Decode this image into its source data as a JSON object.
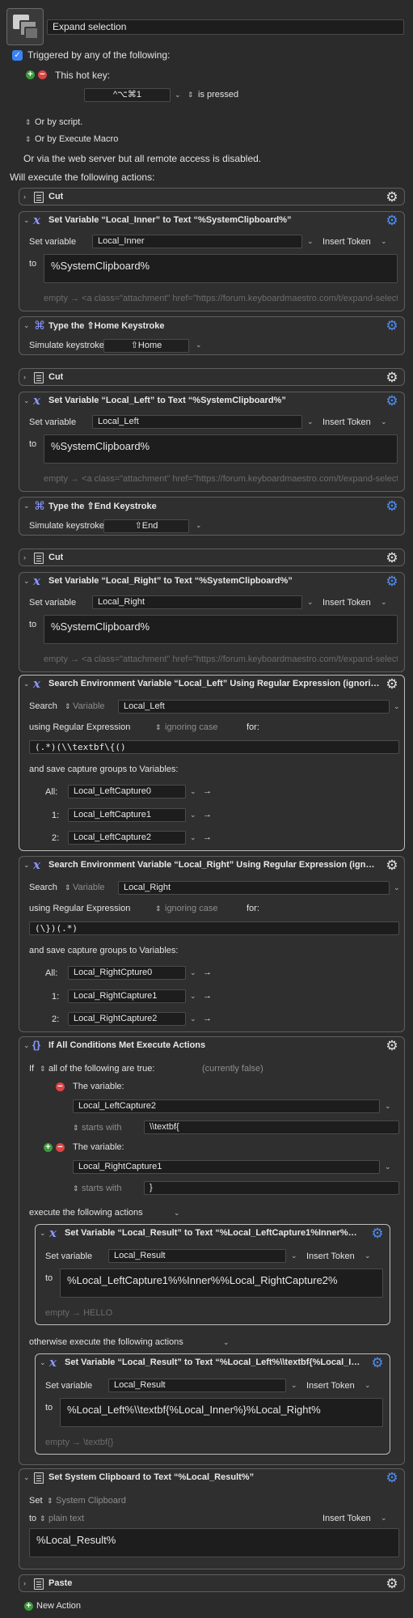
{
  "macro": {
    "name": "Expand selection"
  },
  "trigger": {
    "checkbox_label": "Triggered by any of the following:",
    "hotkey_label": "This hot key:",
    "hotkey_value": "^⌥⌘1",
    "hotkey_state": "is pressed",
    "or_by_script": "Or by script.",
    "or_by_macro": "Or by Execute Macro",
    "web_server": "Or via the web server but all remote access is disabled.",
    "will_execute": "Will execute the following actions:"
  },
  "common": {
    "set_variable": "Set variable",
    "to": "to",
    "insert_token": "Insert Token",
    "simulate_keystroke": "Simulate keystroke:",
    "search": "Search",
    "variable": "Variable",
    "using_regex": "using Regular Expression",
    "ignoring_case": "ignoring case",
    "for": "for:",
    "save_capture": "and save capture groups to Variables:",
    "all": "All:",
    "one": "1:",
    "two": "2:",
    "link_placeholder": "empty → <a class=\"attachment\" href=\"https://forum.keyboardmaestro.com/t/expand-selection-macro/"
  },
  "actions": [
    {
      "title": "Cut"
    },
    {
      "title": "Set Variable “Local_Inner” to Text “%SystemClipboard%”",
      "var": "Local_Inner",
      "text": "%SystemClipboard%"
    },
    {
      "title": "Type the ⇧Home Keystroke",
      "key": "⇧Home"
    },
    {
      "title": "Cut"
    },
    {
      "title": "Set Variable “Local_Left” to Text “%SystemClipboard%”",
      "var": "Local_Left",
      "text": "%SystemClipboard%"
    },
    {
      "title": "Type the ⇧End Keystroke",
      "key": "⇧End"
    },
    {
      "title": "Cut"
    },
    {
      "title": "Set Variable “Local_Right” to Text “%SystemClipboard%”",
      "var": "Local_Right",
      "text": "%SystemClipboard%"
    },
    {
      "title": "Search Environment Variable “Local_Left” Using Regular Expression (ignoring case)",
      "var": "Local_Left",
      "regex": "(.*)(\\\\textbf\\{()",
      "all": "Local_LeftCapture0",
      "c1": "Local_LeftCapture1",
      "c2": "Local_LeftCapture2"
    },
    {
      "title": "Search Environment Variable “Local_Right” Using Regular Expression (ignoring case)",
      "var": "Local_Right",
      "regex": "(\\})(.*)",
      "all": "Local_RightCpture0",
      "c1": "Local_RightCapture1",
      "c2": "Local_RightCapture2"
    },
    {
      "title": "If All Conditions Met Execute Actions",
      "if": "If",
      "all_following": "all of the following are true:",
      "currently": "(currently false)",
      "the_variable": "The variable:",
      "cond1_var": "Local_LeftCapture2",
      "starts_with": "starts with",
      "cond1_val": "\\\\textbf{",
      "cond2_var": "Local_RightCapture1",
      "cond2_val": "}",
      "execute_following": "execute the following actions",
      "then_title": "Set Variable “Local_Result” to Text “%Local_LeftCapture1%Inner%%Local_RightCapture2%”",
      "then_var": "Local_Result",
      "then_text": "%Local_LeftCapture1%%Inner%%Local_RightCapture2%",
      "then_preview": "empty → HELLO",
      "otherwise": "otherwise execute the following actions",
      "else_title": "Set Variable “Local_Result” to Text “%Local_Left%\\\\textbf{%Local_Inner%}%Local_Right%”",
      "else_var": "Local_Result",
      "else_text": "%Local_Left%\\\\textbf{%Local_Inner%}%Local_Right%",
      "else_preview": "empty → \\textbf{}"
    },
    {
      "title": "Set System Clipboard to Text “%Local_Result%”",
      "set": "Set",
      "clipboard": "System Clipboard",
      "to": "to",
      "plain": "plain text",
      "text": "%Local_Result%"
    },
    {
      "title": "Paste"
    }
  ],
  "footer": {
    "new_action": "New Action"
  },
  "colors": {
    "accent": "#4e8df5",
    "icon": "#8b96ff",
    "remove": "#dd4444",
    "add": "#3c9b3c"
  }
}
